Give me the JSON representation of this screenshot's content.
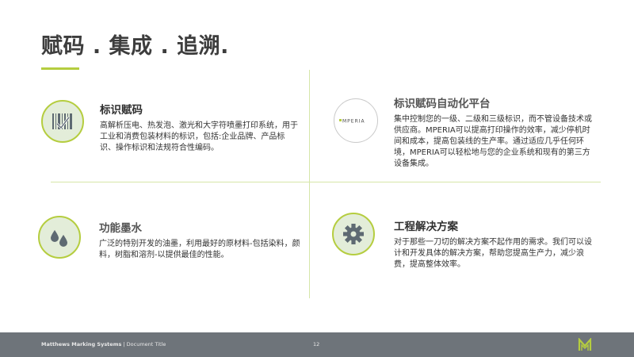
{
  "slide": {
    "title": "赋码 . 集成 . 追溯."
  },
  "sections": [
    {
      "heading": "标识赋码",
      "body": "高解析压电、热发泡、激光和大字符喷墨打印系统，用于工业和消费包装材料的标识，包括:企业品牌、产品标识、操作标识和法规符合性编码。",
      "icon": "barcode-icon"
    },
    {
      "heading": "标识赋码自动化平台",
      "body": "集中控制您的一级、二级和三级标识，而不管设备技术或供应商。MPERIA可以提高打印操作的效率，减少停机时间和成本，提高包装线的生产率。通过适应几乎任何环境，MPERIA可以轻松地与您的企业系统和现有的第三方设备集成。",
      "icon": "mperia-logo",
      "logo_text": "MPERIA"
    },
    {
      "heading": "功能墨水",
      "body": "广泛的特别开发的油墨，利用最好的原材料-包括染料，颜料，树脂和溶剂-以提供最佳的性能。",
      "icon": "ink-drops-icon"
    },
    {
      "heading": "工程解决方案",
      "body": "对于那些一刀切的解决方案不起作用的需求。我们可以设计和开发具体的解决方案，帮助您提高生产力，减少浪费，提高整体效率。",
      "icon": "gear-icon"
    }
  ],
  "footer": {
    "company": "Matthews Marking Systems",
    "separator": " | ",
    "doc_title": "Document Title",
    "page_number": "12"
  },
  "colors": {
    "accent": "#b5cd3f",
    "icon_fill": "#e3edd9",
    "icon_glyph": "#5e6a72",
    "footer_bg": "#6e747a"
  }
}
